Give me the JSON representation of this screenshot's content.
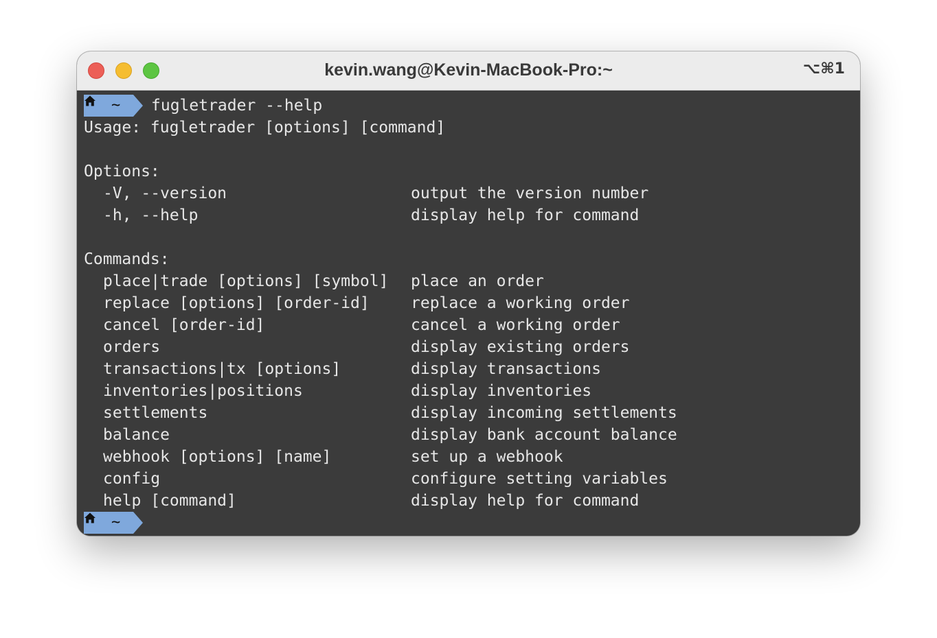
{
  "window": {
    "title": "kevin.wang@Kevin-MacBook-Pro:~",
    "shortcut": "⌥⌘1"
  },
  "theme": {
    "terminal_bg": "#3b3b3b",
    "text_color": "#e6e6e6",
    "prompt_bg": "#7fa8dc",
    "titlebar_bg": "#ececec"
  },
  "prompt": {
    "icon": "home-icon",
    "path": "~"
  },
  "terminal": {
    "command": "fugletrader --help",
    "usage": "Usage: fugletrader [options] [command]",
    "options_header": "Options:",
    "options": [
      {
        "flag": "-V, --version",
        "desc": "output the version number"
      },
      {
        "flag": "-h, --help",
        "desc": "display help for command"
      }
    ],
    "commands_header": "Commands:",
    "commands": [
      {
        "name": "place|trade [options] [symbol]",
        "desc": "place an order"
      },
      {
        "name": "replace [options] [order-id]",
        "desc": "replace a working order"
      },
      {
        "name": "cancel [order-id]",
        "desc": "cancel a working order"
      },
      {
        "name": "orders",
        "desc": "display existing orders"
      },
      {
        "name": "transactions|tx [options]",
        "desc": "display transactions"
      },
      {
        "name": "inventories|positions",
        "desc": "display inventories"
      },
      {
        "name": "settlements",
        "desc": "display incoming settlements"
      },
      {
        "name": "balance",
        "desc": "display bank account balance"
      },
      {
        "name": "webhook [options] [name]",
        "desc": "set up a webhook"
      },
      {
        "name": "config",
        "desc": "configure setting variables"
      },
      {
        "name": "help [command]",
        "desc": "display help for command"
      }
    ]
  }
}
